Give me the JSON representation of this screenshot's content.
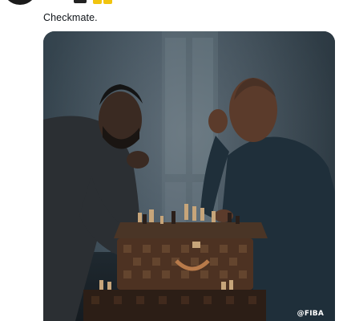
{
  "tweet": {
    "text": "Checkmate."
  },
  "media": {
    "watermark": "@FIBA"
  },
  "colors": {
    "background": "#ffffff",
    "text": "#0f1419",
    "emoji": "#f1c40f"
  }
}
